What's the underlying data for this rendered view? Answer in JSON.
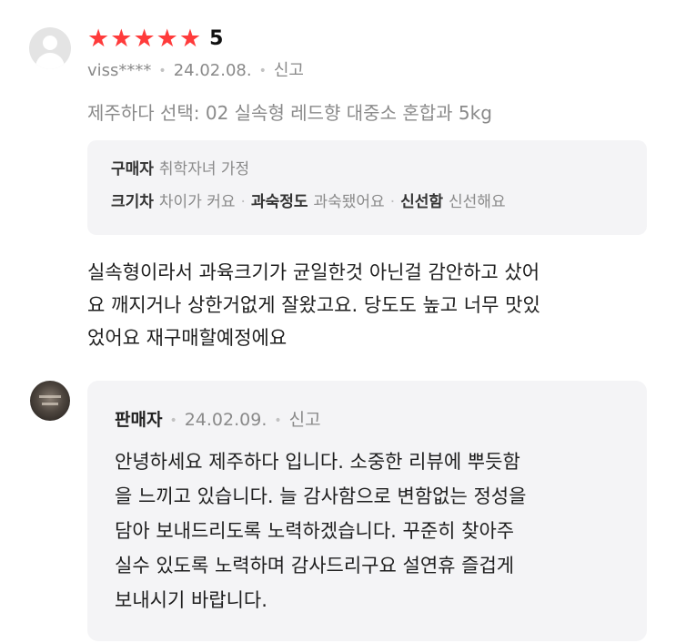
{
  "review": {
    "rating": "5",
    "star_count": 5,
    "star_color": "#ff3b3b",
    "user": "viss****",
    "date": "24.02.08.",
    "report_label": "신고",
    "option": "제주하다 선택: 02 실속형 레드향 대중소 혼합과 5kg",
    "survey": {
      "buyer_key": "구매자",
      "buyer_value": "취학자녀 가정",
      "size_key": "크기차",
      "size_value": "차이가 커요",
      "ripeness_key": "과숙정도",
      "ripeness_value": "과숙됐어요",
      "fresh_key": "신선함",
      "fresh_value": "신선해요"
    },
    "text_lines": [
      "실속형이라서 과육크기가 균일한것 아닌걸 감안하고 샀어",
      "요 깨지거나 상한거없게 잘왔고요. 당도도 높고 너무 맛있",
      "었어요 재구매할예정에요"
    ]
  },
  "seller": {
    "name": "판매자",
    "date": "24.02.09.",
    "report_label": "신고",
    "reply_lines": [
      "안녕하세요 제주하다 입니다. 소중한 리뷰에 뿌듯함",
      "을 느끼고 있습니다. 늘 감사함으로 변함없는 정성을",
      "담아 보내드리도록 노력하겠습니다. 꾸준히 찾아주",
      "실수 있도록 노력하며 감사드리구요 설연휴 즐겁게",
      "보내시기 바랍니다."
    ]
  }
}
